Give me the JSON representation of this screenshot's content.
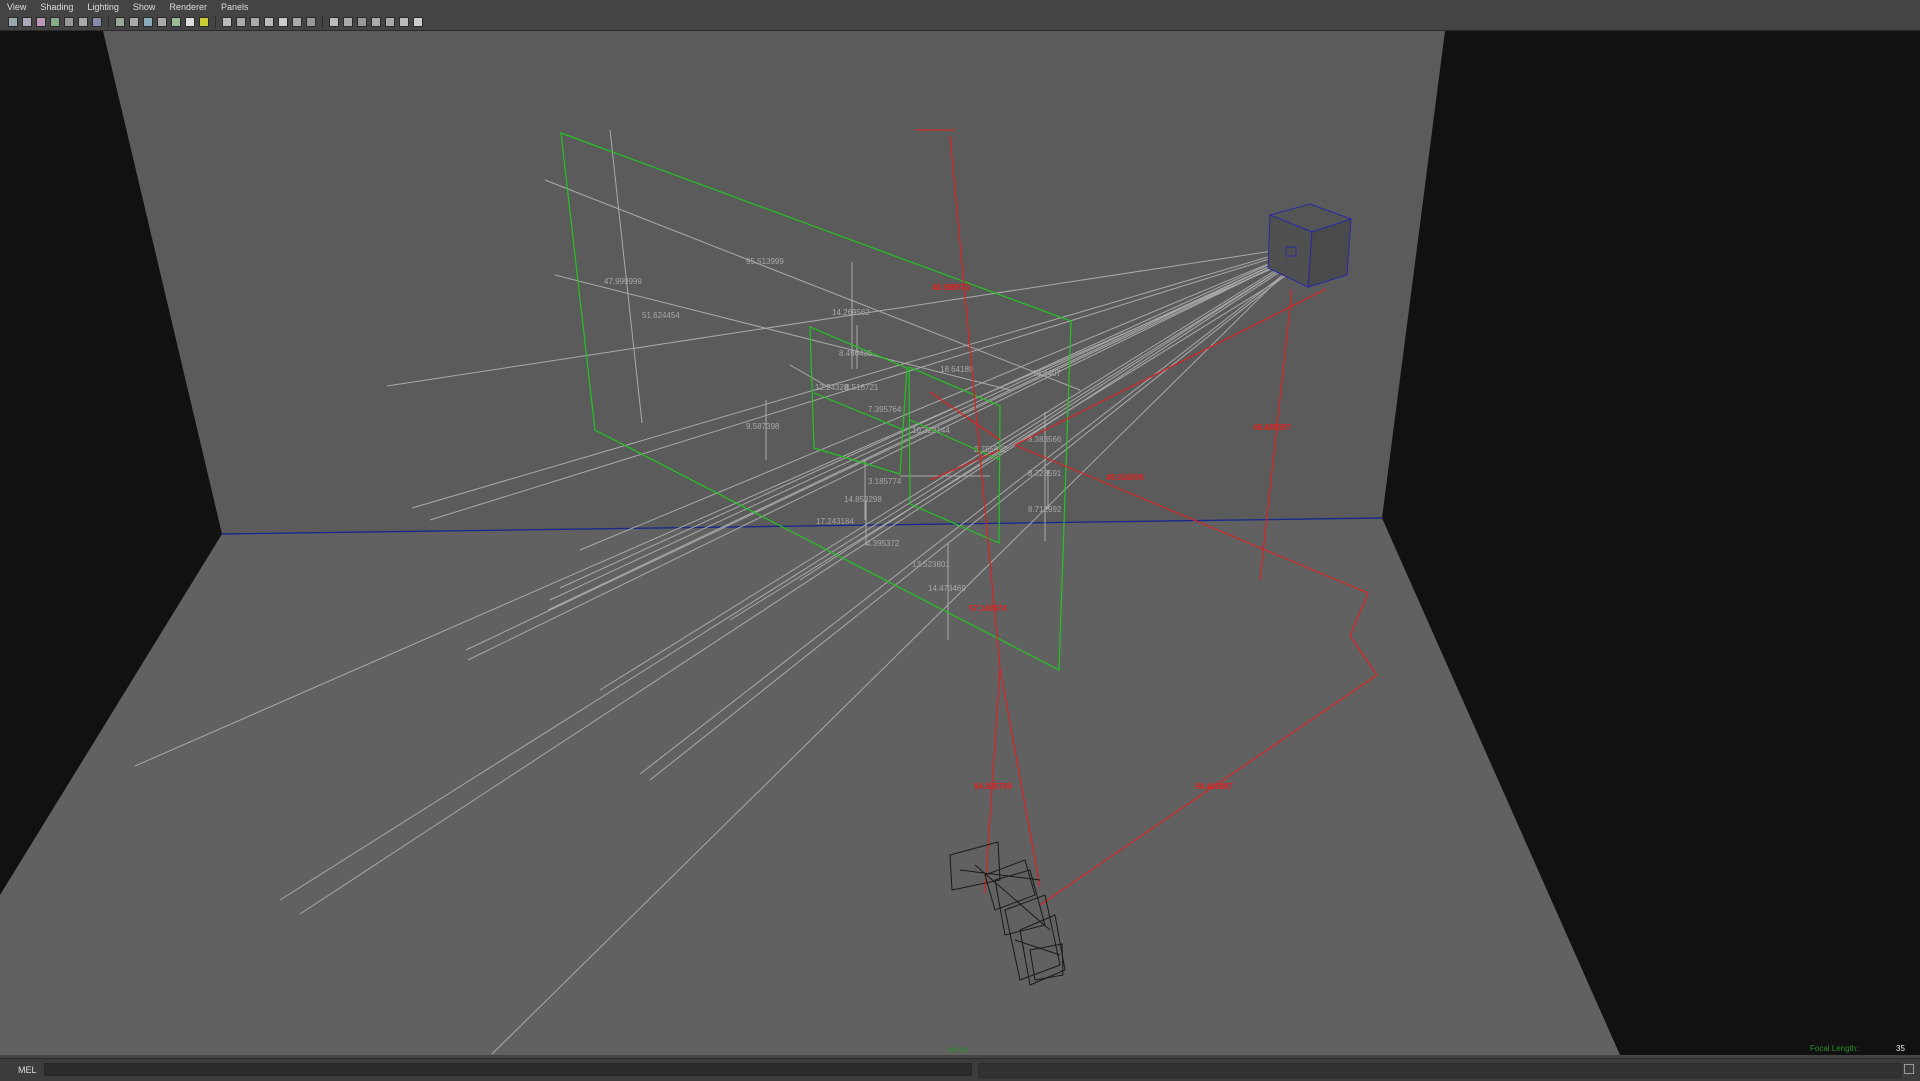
{
  "menu": [
    "View",
    "Shading",
    "Lighting",
    "Show",
    "Renderer",
    "Panels"
  ],
  "toolbar_icons": [
    "select-camera-icon",
    "camera-attributes-icon",
    "bookmark-icon",
    "image-plane-icon",
    "gate-icon",
    "film-gate-icon",
    "resolution-gate-icon",
    "safe-action-icon",
    "grid-icon",
    "wireframe-icon",
    "smooth-shade-icon",
    "flat-shade-icon",
    "bounding-box-icon",
    "points-icon",
    "textured-icon",
    "lights-icon",
    "shadows-icon",
    "isolate-icon",
    "xray-icon",
    "xray-joints-icon",
    "backface-icon",
    "ambient-occlusion-icon",
    "motion-blur-icon",
    "multisample-icon",
    "depth-of-field-icon",
    "film-back-icon",
    "show-grid-icon",
    "toggle-panel-icon"
  ],
  "viewport": {
    "camera": "persp",
    "focal_label": "Focal Length:",
    "focal_value": "35",
    "grey_dims": [
      "47.999999",
      "95.513999",
      "51.624454",
      "14.269562",
      "8.496435",
      "12.24328",
      "8.516721",
      "7.395764",
      "9.587398",
      "13.8407",
      "10.323144",
      "2.755992",
      "8.383566",
      "8.323591",
      "8.712992",
      "3.185774",
      "14.853298",
      "17.243184",
      "4.395372",
      "13.523801",
      "14.473469",
      "18.64189"
    ],
    "red_dims": [
      "48.988973",
      "48.488397",
      "49.016896",
      "57.149974",
      "94.835789",
      "90.402897"
    ]
  },
  "command": {
    "label": "MEL",
    "value": ""
  },
  "colors": {
    "background": "#5d5d5d",
    "wall_side": "#111111",
    "green_wire": "#22c422",
    "red_wire": "#e02020",
    "horizon": "#1a2a8a"
  }
}
